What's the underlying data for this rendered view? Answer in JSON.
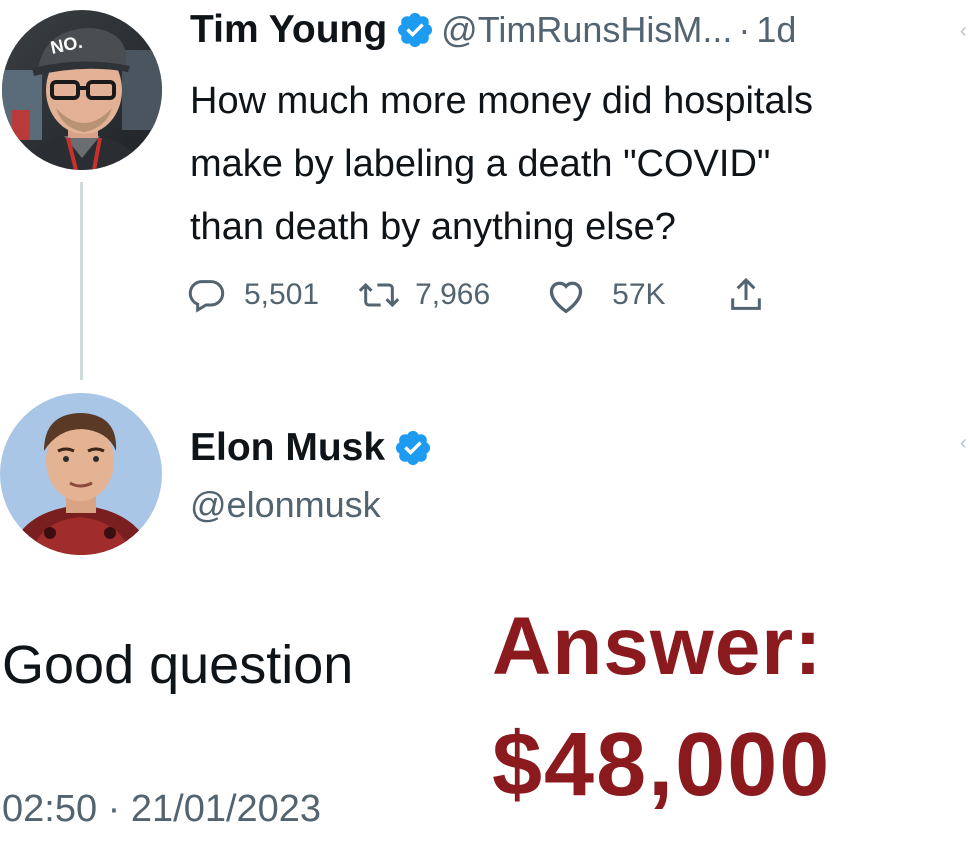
{
  "original_tweet": {
    "author_name": "Tim Young",
    "handle": "@TimRunsHisM...",
    "separator": "·",
    "age": "1d",
    "verified": true,
    "text_lines": [
      "How much more money did hospitals",
      "make by labeling a death \"COVID\"",
      "than death by anything else?"
    ],
    "actions": {
      "replies": "5,501",
      "retweets": "7,966",
      "likes": "57K"
    },
    "icons": [
      "reply-icon",
      "retweet-icon",
      "like-icon",
      "share-icon",
      "verified-badge-icon"
    ]
  },
  "reply_tweet": {
    "author_name": "Elon Musk",
    "handle": "@elonmusk",
    "verified": true,
    "text": "Good question",
    "timestamp": "02:50 · 21/01/2023"
  },
  "overlay": {
    "label": "Answer:",
    "value": "$48,000"
  },
  "colors": {
    "text_primary": "#0f1419",
    "text_secondary": "#536471",
    "verified_blue": "#1d9bf0",
    "overlay_red": "#8b1a1e",
    "thread_line": "#cfd9de"
  }
}
